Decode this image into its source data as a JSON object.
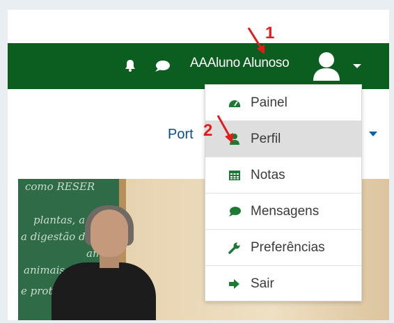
{
  "navbar": {
    "user_name": "AAAluno Alunoso",
    "bell_icon": "bell-icon",
    "chat_icon": "chat-icon",
    "avatar_icon": "user-avatar-icon",
    "bg_color": "#0b5e1f"
  },
  "language": {
    "label": "Port"
  },
  "user_menu": {
    "items": [
      {
        "label": "Painel",
        "icon": "dashboard-icon"
      },
      {
        "label": "Perfil",
        "icon": "user-icon"
      },
      {
        "label": "Notas",
        "icon": "table-icon"
      },
      {
        "label": "Mensagens",
        "icon": "message-icon"
      },
      {
        "label": "Preferências",
        "icon": "wrench-icon"
      },
      {
        "label": "Sair",
        "icon": "sign-out-icon"
      }
    ],
    "highlight_color": "#dedede",
    "icon_color": "#1d7a34"
  },
  "annotations": {
    "marker_1": "1",
    "marker_2": "2",
    "color": "#e31b1b"
  },
  "photo": {
    "board_lines": [
      "como RESER",
      "plantas, a",
      "a digestão d",
      "amido",
      "animais,",
      "e prot"
    ]
  }
}
